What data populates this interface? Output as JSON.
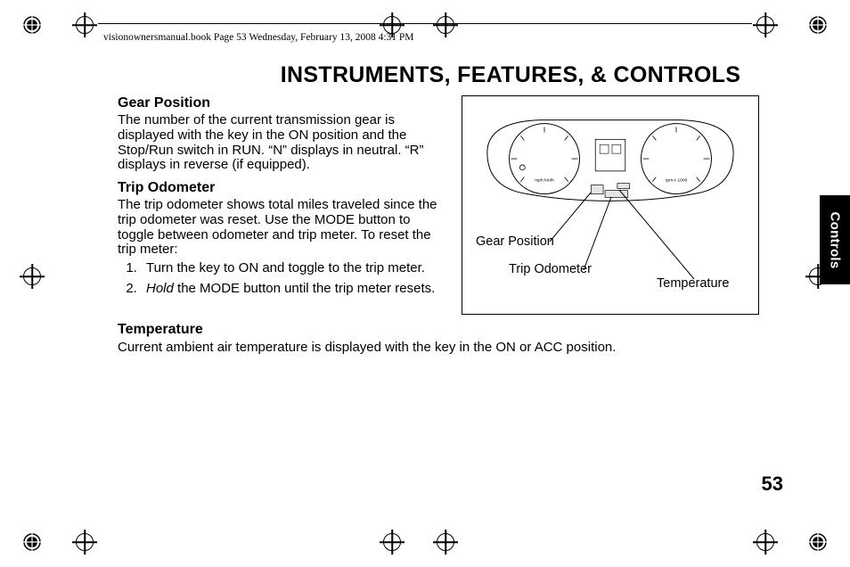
{
  "header": {
    "running_head": "visionownersmanual.book  Page 53  Wednesday, February 13, 2008  4:31 PM"
  },
  "page": {
    "title": "INSTRUMENTS, FEATURES, & CONTROLS",
    "number": "53",
    "side_tab": "Controls"
  },
  "sections": {
    "gear_position": {
      "heading": "Gear Position",
      "body": "The number of the current transmission gear is displayed with the key in the ON position and the Stop/Run switch in RUN. “N” displays in neutral. “R” displays in reverse (if equipped)."
    },
    "trip_odometer": {
      "heading": "Trip Odometer",
      "intro": "The trip odometer shows total miles traveled since the trip odometer was reset. Use the MODE button to toggle between odometer and trip meter. To reset the trip meter:",
      "steps": [
        "Turn the key to ON and toggle to the trip meter.",
        "Hold the MODE button until the trip meter resets."
      ],
      "step2_emphasis": "Hold"
    },
    "temperature": {
      "heading": "Temperature",
      "body": "Current ambient air temperature is displayed with the key in the ON or ACC position."
    }
  },
  "figure": {
    "callouts": {
      "gear_position": "Gear Position",
      "trip_odometer": "Trip Odometer",
      "temperature": "Temperature"
    }
  }
}
